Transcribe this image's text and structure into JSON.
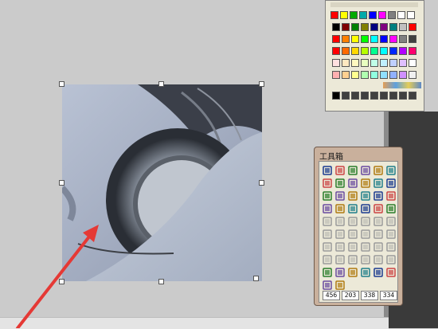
{
  "toolbox": {
    "title": "工具箱",
    "coords": [
      "456",
      "203",
      "338",
      "334"
    ]
  },
  "colors": {
    "canvas_bg": "#cbcbcb",
    "selection_handle": "#ffffff",
    "arrow": "#e53935",
    "toolbox_frame": "#c9b09c",
    "palette_frame": "#ece9d8"
  },
  "palette": {
    "rows": [
      [
        "#000000",
        "#800000",
        "#008000",
        "#808000",
        "#000080",
        "#800080",
        "#008080",
        "#c0c0c0",
        "#ff0000"
      ],
      [
        "#ff0000",
        "#ff8000",
        "#ffff00",
        "#00ff00",
        "#00ffff",
        "#0000ff",
        "#ff00ff",
        "#808080",
        "#404040"
      ],
      [
        "#ff0000",
        "#ff6a00",
        "#ffd800",
        "#b6ff00",
        "#00ff90",
        "#00ffff",
        "#0026ff",
        "#b200ff",
        "#ff006e"
      ],
      [
        "#ffe0e0",
        "#ffe8c0",
        "#fff8c0",
        "#e8ffc0",
        "#c0ffe8",
        "#c0f0ff",
        "#c0d0ff",
        "#e0c0ff",
        "#ffffff"
      ],
      [
        "#ffb0b0",
        "#ffd090",
        "#ffff90",
        "#b0ffb0",
        "#90ffe0",
        "#90e0ff",
        "#90b0ff",
        "#d090ff",
        "#f0f0f0"
      ]
    ],
    "bottom_row": [
      "#000000",
      "#404040",
      "#404040",
      "#404040",
      "#404040",
      "#404040",
      "#404040",
      "#404040",
      "#404040"
    ]
  },
  "tools": [
    "new-page-icon",
    "open-folder-icon",
    "stamp-icon",
    "save-disk-icon",
    "screen-capture-icon",
    "green-box-icon",
    "select-arrow-icon",
    "line-icon",
    "ellipse-outline-icon",
    "ellipse-fill-icon",
    "rectangle-fill-icon",
    "rect-outline-icon",
    "corner-line-icon",
    "pie-icon",
    "text-icon",
    "rounded-rect-icon",
    "image-icon",
    "pencil-icon",
    "layer-image-icon",
    "copy-image-icon",
    "pattern-icon",
    "frame-icon",
    "crop-icon",
    "pen-brush-icon",
    "color-dots-icon",
    "undo-icon",
    "redo-icon",
    "scissors-icon",
    "copy-icon",
    "paste-icon",
    "group-icon",
    "ungroup-icon",
    "align-icon",
    "distribute-icon",
    "flip-icon",
    "rotate-icon",
    "align-left-icon",
    "align-center-icon",
    "align-right-icon",
    "align-top-icon",
    "align-middle-icon",
    "align-bottom-icon",
    "bring-front-icon",
    "send-back-icon",
    "order-icon",
    "grid-icon",
    "snap-icon",
    "guide-icon",
    "dotted-line-icon",
    "dash-line-icon",
    "vertical-dots-icon",
    "table-icon",
    "color-grid-icon",
    "fill-pattern-icon",
    "color-swatch-icon",
    "line-width-icon"
  ]
}
